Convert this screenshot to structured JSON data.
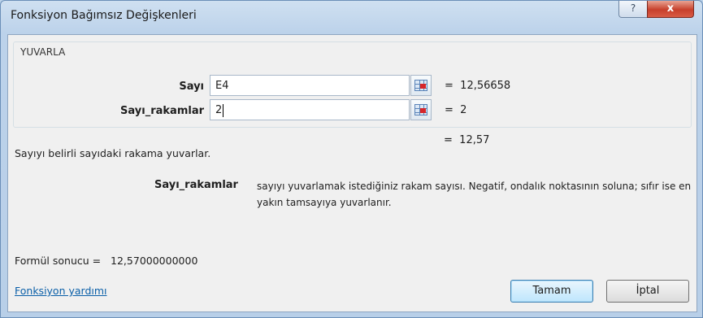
{
  "window": {
    "title": "Fonksiyon Bağımsız Değişkenleri",
    "help_label": "?",
    "close_label": "x"
  },
  "function": {
    "name": "YUVARLA",
    "args": [
      {
        "label": "Sayı",
        "value": "E4",
        "result": "12,56658"
      },
      {
        "label": "Sayı_rakamlar",
        "value": "2",
        "result": "2"
      }
    ],
    "total_result": "12,57"
  },
  "description": {
    "function_text": "Sayıyı belirli sayıdaki rakama yuvarlar.",
    "arg_name": "Sayı_rakamlar",
    "arg_text": "sayıyı yuvarlamak istediğiniz rakam sayısı. Negatif, ondalık noktasının soluna; sıfır ise en yakın tamsayıya yuvarlanır."
  },
  "formula_result": {
    "label": "Formül sonucu =",
    "value": "12,57000000000"
  },
  "footer": {
    "help_link": "Fonksiyon yardımı",
    "ok_label": "Tamam",
    "cancel_label": "İptal"
  },
  "symbols": {
    "equals": "="
  },
  "icons": {
    "collapse_dialog": "collapse-dialog-icon"
  },
  "colors": {
    "title_bar": "#bcd3ea",
    "close_button": "#c7402c",
    "link": "#0a5fa8",
    "default_button": "#bee6fd"
  }
}
